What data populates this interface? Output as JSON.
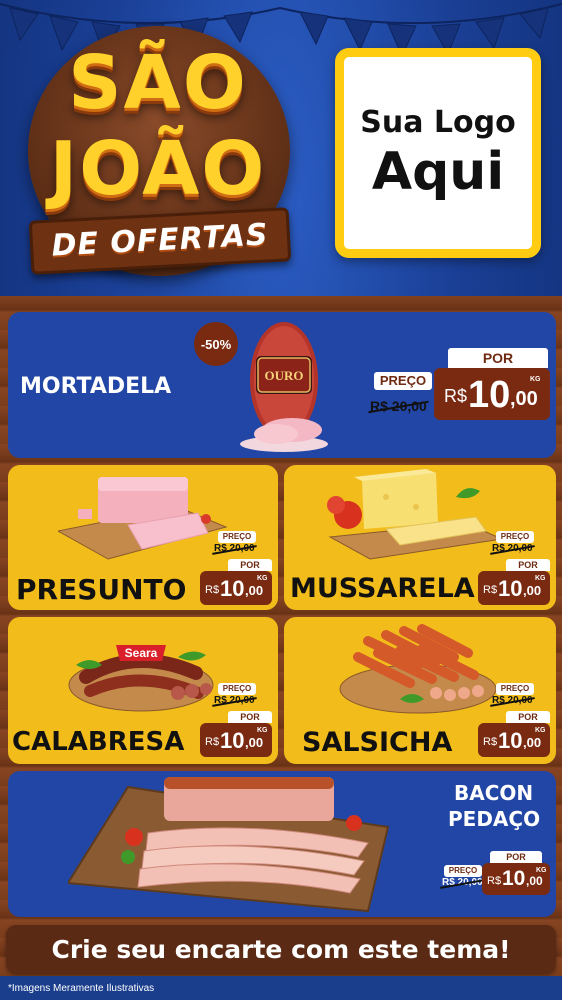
{
  "header": {
    "title_line1": "SÃO",
    "title_line2": "JOÃO",
    "title_line3": "DE OFERTAS",
    "logo_line1": "Sua Logo",
    "logo_line2": "Aqui"
  },
  "products": [
    {
      "name": "MORTADELA",
      "badge": "-50%",
      "brand": "OURO",
      "preco_label": "PREÇO",
      "old_price": "R$ 20,00",
      "por_label": "POR",
      "currency": "R$",
      "price_int": "10",
      "price_cents": ",00",
      "unit": "KG"
    },
    {
      "name": "PRESUNTO",
      "preco_label": "PREÇO",
      "old_price": "R$ 20,00",
      "por_label": "POR",
      "currency": "R$",
      "price_int": "10",
      "price_cents": ",00",
      "unit": "KG"
    },
    {
      "name": "MUSSARELA",
      "preco_label": "PREÇO",
      "old_price": "R$ 20,00",
      "por_label": "POR",
      "currency": "R$",
      "price_int": "10",
      "price_cents": ",00",
      "unit": "KG"
    },
    {
      "name": "CALABRESA",
      "brand": "Seara",
      "preco_label": "PREÇO",
      "old_price": "R$ 20,00",
      "por_label": "POR",
      "currency": "R$",
      "price_int": "10",
      "price_cents": ",00",
      "unit": "KG"
    },
    {
      "name": "SALSICHA",
      "preco_label": "PREÇO",
      "old_price": "R$ 20,00",
      "por_label": "POR",
      "currency": "R$",
      "price_int": "10",
      "price_cents": ",00",
      "unit": "KG"
    },
    {
      "name_line1": "BACON",
      "name_line2": "PEDAÇO",
      "preco_label": "PREÇO",
      "old_price": "R$ 20,00",
      "por_label": "POR",
      "currency": "R$",
      "price_int": "10",
      "price_cents": ",00",
      "unit": "KG"
    }
  ],
  "cta": "Crie seu encarte com este tema!",
  "disclaimer": "*Imagens Meramente Ilustrativas",
  "colors": {
    "blue_card": "#2246a6",
    "yellow_card": "#f2bd1b",
    "price_box": "#7a2a10",
    "logo_border": "#ffcc12"
  }
}
